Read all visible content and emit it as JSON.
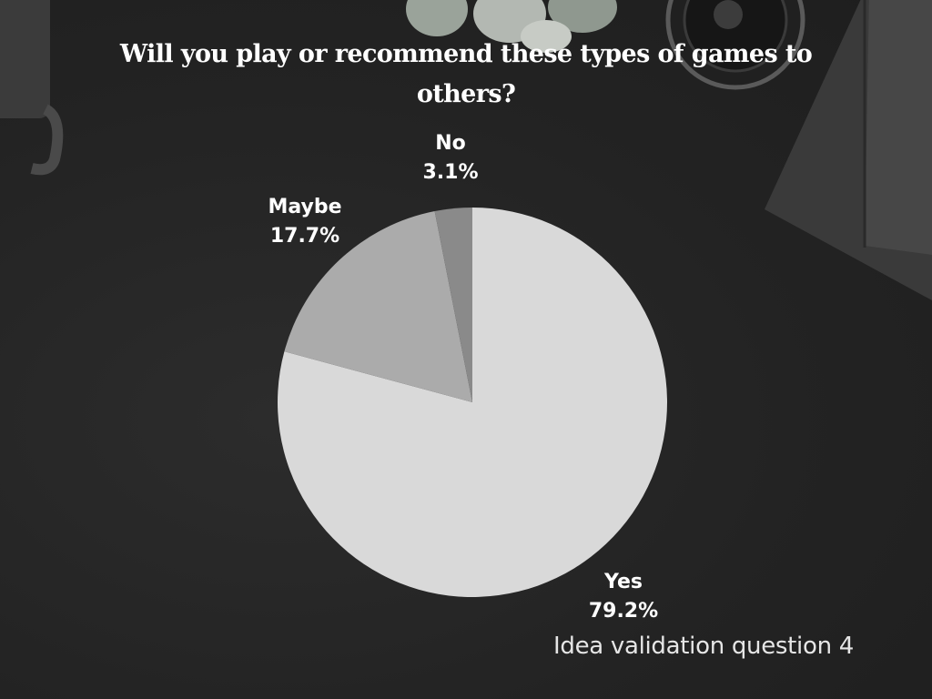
{
  "chart_data": {
    "type": "pie",
    "title": "Will you play or recommend these types of games to others?",
    "slices": [
      {
        "label": "Yes",
        "value": 79.2,
        "value_label": "79.2%",
        "color": "#d9d9d9"
      },
      {
        "label": "Maybe",
        "value": 17.7,
        "value_label": "17.7%",
        "color": "#ababab"
      },
      {
        "label": "No",
        "value": 3.1,
        "value_label": "3.1%",
        "color": "#8a8a8a"
      }
    ],
    "start_angle": "12 o'clock",
    "direction": "clockwise"
  },
  "caption": "Idea validation question 4",
  "colors": {
    "background": "#262626",
    "text": "#ffffff"
  }
}
